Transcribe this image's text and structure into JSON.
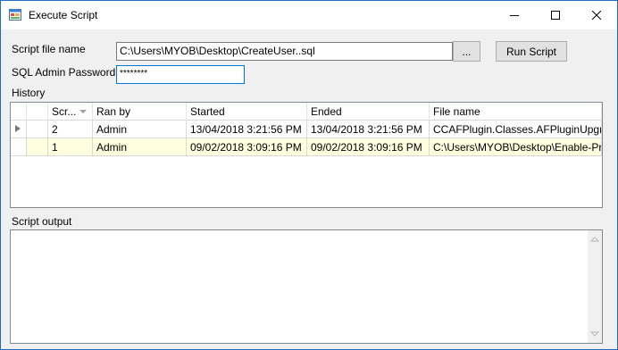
{
  "window": {
    "title": "Execute Script",
    "icon": "form-app-icon"
  },
  "form": {
    "script_file_label": "Script file name",
    "script_file_value": "C:\\Users\\MYOB\\Desktop\\CreateUser..sql",
    "browse_label": "...",
    "run_label": "Run Script",
    "password_label": "SQL Admin Password",
    "password_value": "********"
  },
  "history": {
    "label": "History",
    "columns": [
      "Scr...",
      "Ran by",
      "Started",
      "Ended",
      "File name"
    ],
    "rows": [
      {
        "script": "2",
        "ran_by": "Admin",
        "started": "13/04/2018 3:21:56 PM",
        "ended": "13/04/2018 3:21:56 PM",
        "file": "CCAFPlugin.Classes.AFPluginUpgr..."
      },
      {
        "script": "1",
        "ran_by": "Admin",
        "started": "09/02/2018 3:09:16 PM",
        "ended": "09/02/2018 3:09:16 PM",
        "file": "C:\\Users\\MYOB\\Desktop\\Enable-Pr..."
      }
    ]
  },
  "output": {
    "label": "Script output",
    "text": ""
  },
  "colors": {
    "window_border": "#1e6bbf",
    "selected_row": "#ffffe0",
    "input_focus": "#0078d7"
  }
}
